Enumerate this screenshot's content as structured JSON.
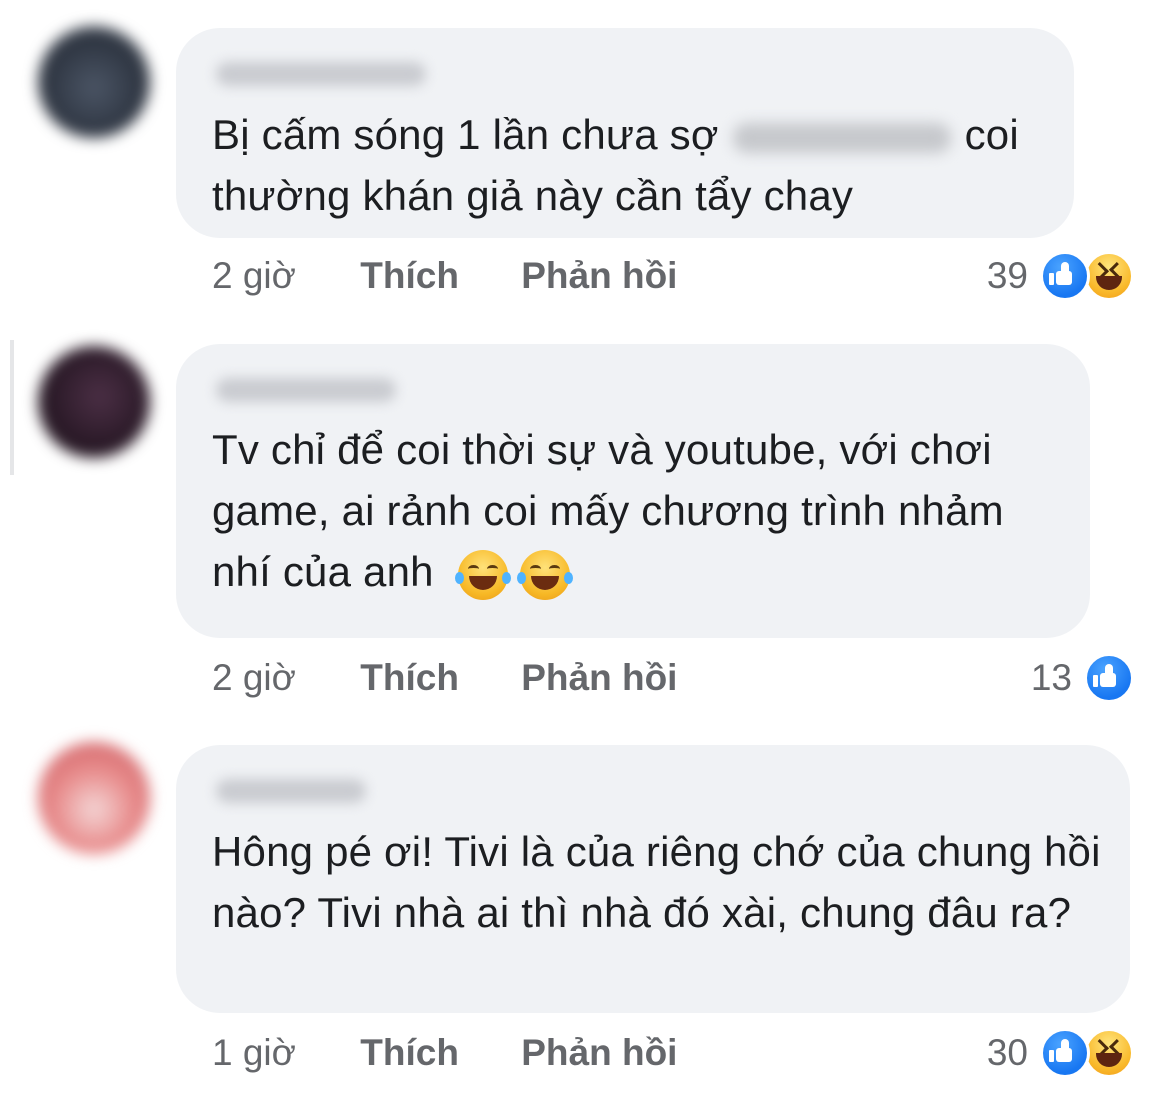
{
  "comments": [
    {
      "text_before": "Bị cấm sóng 1 lần chưa sợ",
      "text_after": "coi thường khán giả này cần tẩy chay",
      "time": "2 giờ",
      "like_label": "Thích",
      "reply_label": "Phản hồi",
      "reaction_count": "39",
      "reactions": [
        "like-icon",
        "haha-icon"
      ],
      "avatar_color": "#3a4250"
    },
    {
      "text": "Tv chỉ để coi thời sự và youtube, với chơi game, ai rảnh coi mấy chương trình nhảm nhí của anh",
      "emoji": [
        "joy-emoji",
        "joy-emoji"
      ],
      "time": "2 giờ",
      "like_label": "Thích",
      "reply_label": "Phản hồi",
      "reaction_count": "13",
      "reactions": [
        "like-icon"
      ],
      "avatar_color": "#2e1f2c"
    },
    {
      "text": "Hông pé ơi! Tivi là của riêng chớ của chung hồi nào? Tivi nhà ai thì nhà đó xài, chung đâu ra?",
      "time": "1 giờ",
      "like_label": "Thích",
      "reply_label": "Phản hồi",
      "reaction_count": "30",
      "reactions": [
        "like-icon",
        "haha-icon"
      ],
      "avatar_color": "#e28a8a"
    }
  ],
  "colors": {
    "bubble": "#f0f2f5",
    "text": "#1c1e21",
    "meta": "#65676b",
    "like": "#1877f2",
    "haha": "#f7b125"
  }
}
